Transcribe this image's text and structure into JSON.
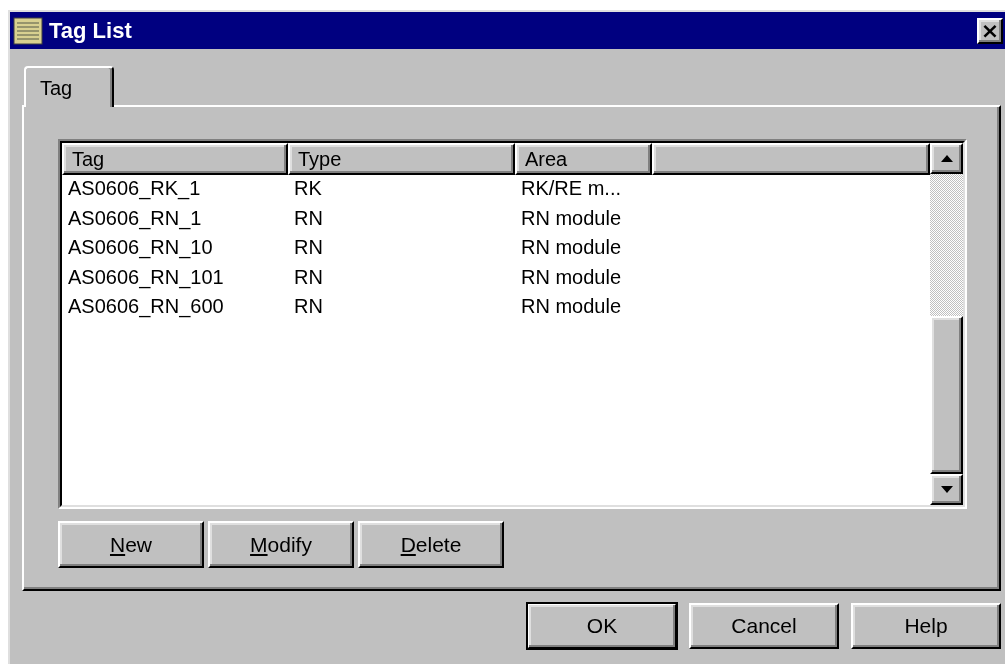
{
  "window": {
    "title": "Tag List",
    "close": "×"
  },
  "tabs": [
    {
      "label": "Tag",
      "selected": true
    }
  ],
  "table": {
    "columns": [
      "Tag",
      "Type",
      "Area"
    ],
    "rows": [
      [
        "AS0606_RK_1",
        "RK",
        "RK/RE m..."
      ],
      [
        "AS0606_RN_1",
        "RN",
        "RN module"
      ],
      [
        "AS0606_RN_10",
        "RN",
        "RN module"
      ],
      [
        "AS0606_RN_101",
        "RN",
        "RN module"
      ],
      [
        "AS0606_RN_600",
        "RN",
        "RN module"
      ]
    ]
  },
  "list_buttons": [
    {
      "label": "New",
      "mnemonic": true
    },
    {
      "label": "Modify",
      "mnemonic": true
    },
    {
      "label": "Delete",
      "mnemonic": true
    }
  ],
  "dialog_buttons": [
    {
      "label": "OK",
      "default": true
    },
    {
      "label": "Cancel",
      "default": false
    },
    {
      "label": "Help",
      "default": false
    }
  ]
}
